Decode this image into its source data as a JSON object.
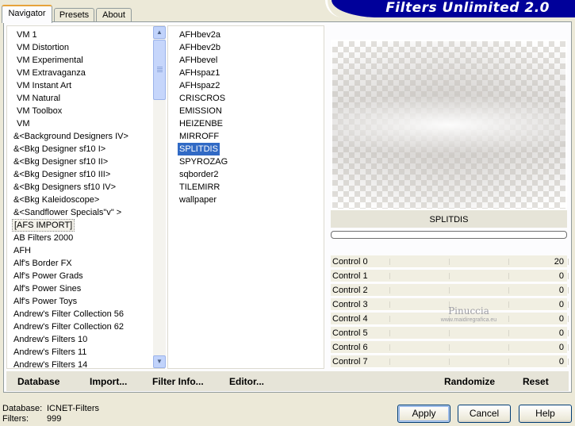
{
  "app": {
    "title": "Filters Unlimited 2.0"
  },
  "tabs": [
    {
      "label": "Navigator",
      "active": true
    },
    {
      "label": "Presets",
      "active": false
    },
    {
      "label": "About",
      "active": false
    }
  ],
  "categories": {
    "items": [
      "VM 1",
      "VM Distortion",
      "VM Experimental",
      "VM Extravaganza",
      "VM Instant Art",
      "VM Natural",
      "VM Toolbox",
      "VM",
      "&<Background Designers IV>",
      "&<Bkg Designer sf10 I>",
      "&<Bkg Designer sf10 II>",
      "&<Bkg Designer sf10 III>",
      "&<Bkg Designers sf10 IV>",
      "&<Bkg Kaleidoscope>",
      "&<Sandflower Specials\"v\" >",
      "[AFS IMPORT]",
      "AB Filters 2000",
      "AFH",
      "Alf's Border FX",
      "Alf's Power Grads",
      "Alf's Power Sines",
      "Alf's Power Toys",
      "Andrew's Filter Collection 56",
      "Andrew's Filter Collection 62",
      "Andrew's Filters 10",
      "Andrew's Filters 11",
      "Andrew's Filters 14"
    ],
    "selected": "[AFS IMPORT]"
  },
  "filters": {
    "items": [
      "AFHbev2a",
      "AFHbev2b",
      "AFHbevel",
      "AFHspaz1",
      "AFHspaz2",
      "CRISCROS",
      "EMISSION",
      "HEIZENBE",
      "MIRROFF",
      "SPLITDIS",
      "SPYROZAG",
      "sqborder2",
      "TILEMIRR",
      "wallpaper"
    ],
    "selected": "SPLITDIS"
  },
  "preview": {
    "filter_name": "SPLITDIS"
  },
  "controls": [
    {
      "label": "Control 0",
      "value": "20"
    },
    {
      "label": "Control 1",
      "value": "0"
    },
    {
      "label": "Control 2",
      "value": "0"
    },
    {
      "label": "Control 3",
      "value": "0"
    },
    {
      "label": "Control 4",
      "value": "0"
    },
    {
      "label": "Control 5",
      "value": "0"
    },
    {
      "label": "Control 6",
      "value": "0"
    },
    {
      "label": "Control 7",
      "value": "0"
    }
  ],
  "watermark": {
    "name": "Pinuccia",
    "url": "www.maidiregrafica.eu"
  },
  "toolbar": {
    "database": "Database",
    "import": "Import...",
    "filter_info": "Filter Info...",
    "editor": "Editor...",
    "randomize": "Randomize",
    "reset": "Reset"
  },
  "status": {
    "database_label": "Database:",
    "database_value": "ICNET-Filters",
    "filters_label": "Filters:",
    "filters_value": "999"
  },
  "buttons": {
    "apply": "Apply",
    "cancel": "Cancel",
    "help": "Help"
  },
  "colors": {
    "banner": "#00009a",
    "selection": "#316ac5",
    "tab_highlight": "#e6a33a"
  }
}
